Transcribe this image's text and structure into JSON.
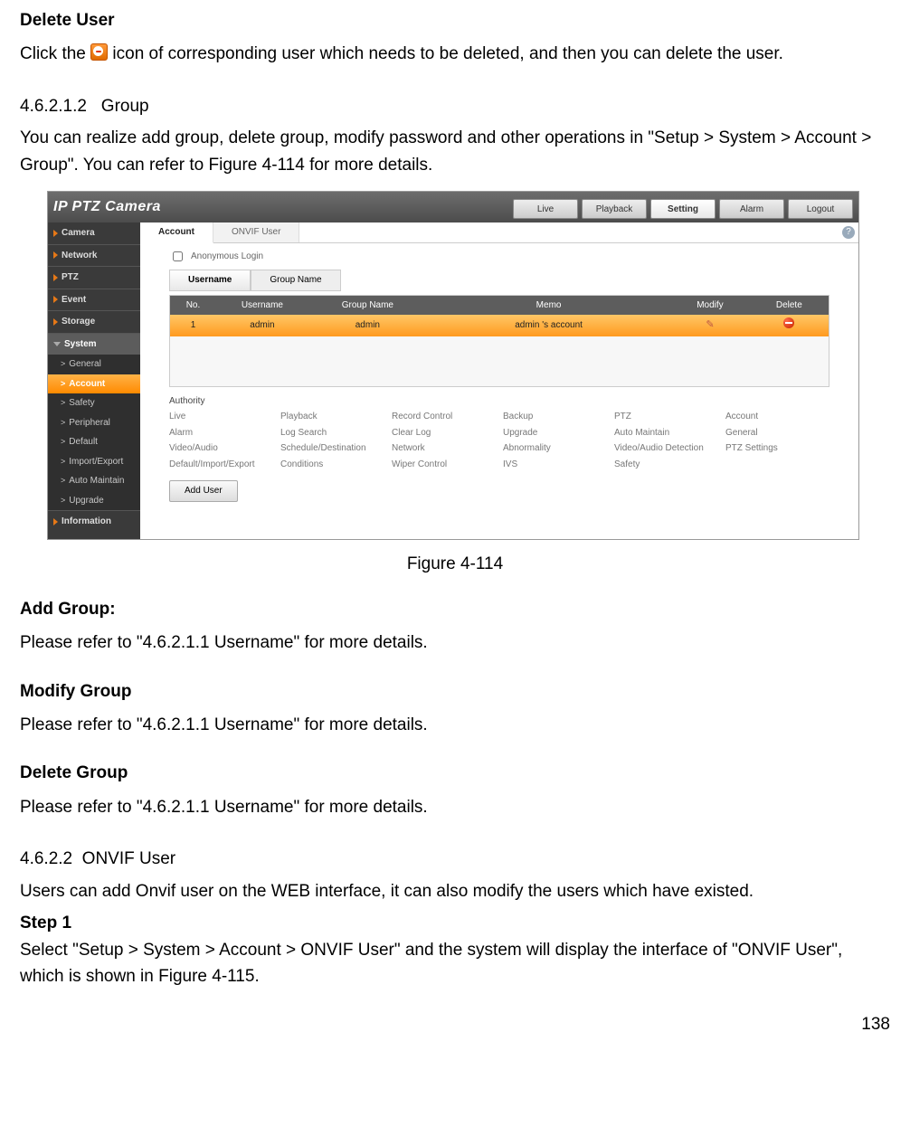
{
  "headings": {
    "delete_user": "Delete User",
    "group_num": "4.6.2.1.2",
    "group_title": "Group",
    "add_group": "Add Group:",
    "modify_group": "Modify Group",
    "delete_group": "Delete Group",
    "onvif_num": "4.6.2.2",
    "onvif_title": "ONVIF User",
    "step1": "Step 1"
  },
  "body": {
    "delete_user_p_a": "Click the ",
    "delete_user_p_b": " icon of corresponding user which needs to be deleted, and then you can delete the user.",
    "group_p": "You can realize add group, delete group, modify password and other operations in \"Setup > System > Account > Group\". You can refer to Figure 4-114 for more details.",
    "refer_username": "Please refer to \"4.6.2.1.1 Username\" for more details.",
    "onvif_intro": "Users can add Onvif user on the WEB interface, it can also modify the users which have existed.",
    "onvif_step1": "Select \"Setup > System > Account > ONVIF User\" and the system will display the interface of \"ONVIF User\", which is shown in Figure 4-115."
  },
  "figure_caption": "Figure 4-114",
  "page_number": "138",
  "shot": {
    "brand": "IP PTZ Camera",
    "topnav": [
      "Live",
      "Playback",
      "Setting",
      "Alarm",
      "Logout"
    ],
    "topnav_active": "Setting",
    "sidebar_cats_before": [
      "Camera",
      "Network",
      "PTZ",
      "Event",
      "Storage"
    ],
    "sidebar_system": "System",
    "sidebar_system_subs": [
      "General",
      "Account",
      "Safety",
      "Peripheral",
      "Default",
      "Import/Export",
      "Auto Maintain",
      "Upgrade"
    ],
    "sidebar_system_sel": "Account",
    "sidebar_cats_after": [
      "Information"
    ],
    "tabs": [
      "Account",
      "ONVIF User"
    ],
    "tabs_active": "Account",
    "anon_label": "Anonymous Login",
    "subtabs": [
      "Username",
      "Group Name"
    ],
    "subtabs_active": "Username",
    "table_headers": [
      "No.",
      "Username",
      "Group Name",
      "Memo",
      "Modify",
      "Delete"
    ],
    "table_row": {
      "no": "1",
      "user": "admin",
      "group": "admin",
      "memo": "admin 's account"
    },
    "authority_label": "Authority",
    "authority_items": [
      "Live",
      "Playback",
      "Record Control",
      "Backup",
      "PTZ",
      "Account",
      "Alarm",
      "Log Search",
      "Clear Log",
      "Upgrade",
      "Auto Maintain",
      "General",
      "Video/Audio",
      "Schedule/Destination",
      "Network",
      "Abnormality",
      "Video/Audio Detection",
      "PTZ Settings",
      "Default/Import/Export",
      "Conditions",
      "Wiper Control",
      "IVS",
      "Safety",
      ""
    ],
    "add_user_btn": "Add User",
    "help": "?"
  }
}
